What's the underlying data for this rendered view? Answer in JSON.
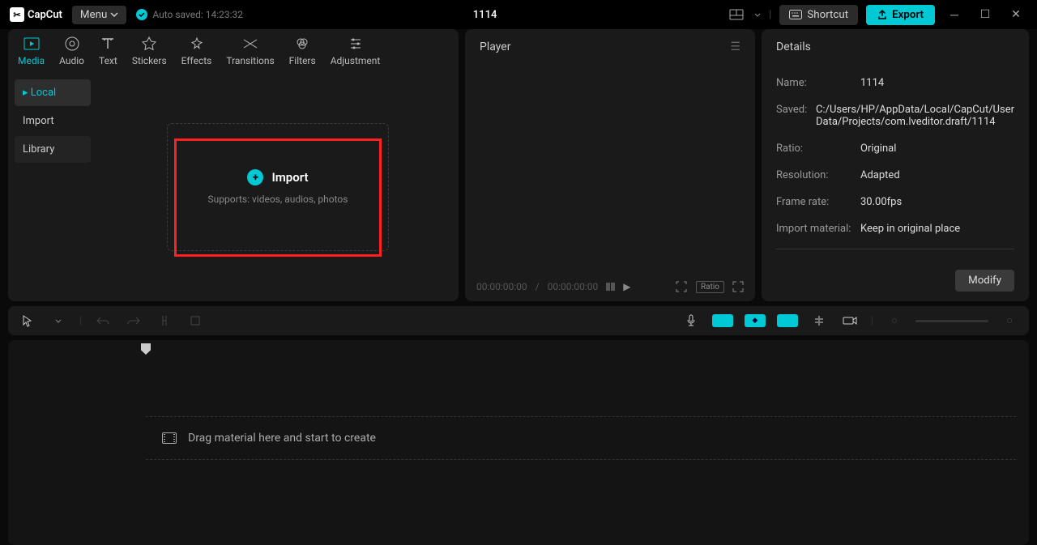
{
  "app": {
    "name": "CapCut"
  },
  "titlebar": {
    "menu_label": "Menu",
    "autosave_label": "Auto saved: 14:23:32",
    "project_title": "1114",
    "shortcut_label": "Shortcut",
    "export_label": "Export"
  },
  "top_tabs": [
    {
      "label": "Media",
      "active": true
    },
    {
      "label": "Audio"
    },
    {
      "label": "Text"
    },
    {
      "label": "Stickers"
    },
    {
      "label": "Effects"
    },
    {
      "label": "Transitions"
    },
    {
      "label": "Filters"
    },
    {
      "label": "Adjustment"
    }
  ],
  "sidebar": {
    "items": [
      {
        "label": "Local",
        "state": "active"
      },
      {
        "label": "Import",
        "state": ""
      },
      {
        "label": "Library",
        "state": "lib"
      }
    ]
  },
  "import_box": {
    "label": "Import",
    "sub": "Supports: videos, audios, photos"
  },
  "player": {
    "title": "Player",
    "time_current": "00:00:00:00",
    "time_total": "00:00:00:00",
    "ratio_label": "Ratio"
  },
  "details": {
    "title": "Details",
    "rows": [
      {
        "label": "Name:",
        "value": "1114"
      },
      {
        "label": "Saved:",
        "value": "C:/Users/HP/AppData/Local/CapCut/User Data/Projects/com.lveditor.draft/1114"
      },
      {
        "label": "Ratio:",
        "value": "Original"
      },
      {
        "label": "Resolution:",
        "value": "Adapted"
      },
      {
        "label": "Frame rate:",
        "value": "30.00fps"
      },
      {
        "label": "Import material:",
        "value": "Keep in original place"
      }
    ],
    "modify_label": "Modify"
  },
  "timeline": {
    "drag_hint": "Drag material here and start to create"
  }
}
